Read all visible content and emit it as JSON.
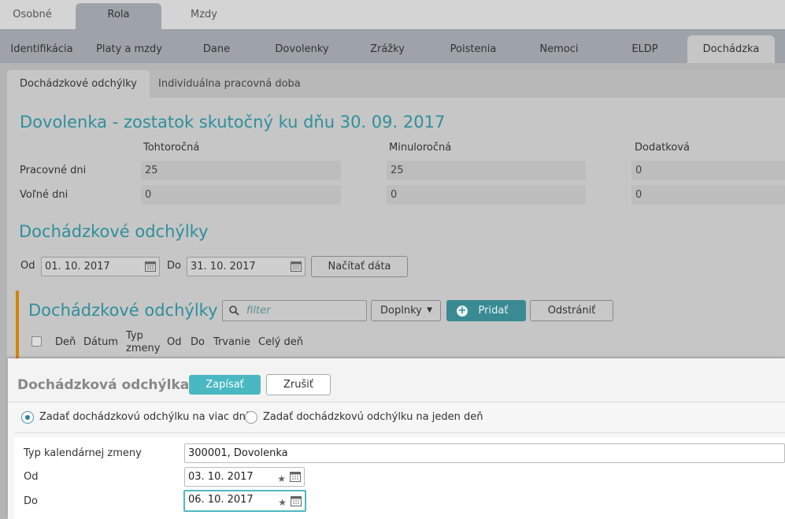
{
  "top_tabs": [
    "Osobné",
    "Rola",
    "Mzdy"
  ],
  "sub_tabs": [
    "Identifikácia",
    "Platy a mzdy",
    "Dane",
    "Dovolenky",
    "Zrážky",
    "Poistenia",
    "Nemoci",
    "ELDP",
    "Dochádzka"
  ],
  "inner_tabs": [
    "Dochádzkové odchýlky",
    "Individuálna pracovná doba"
  ],
  "vacation": {
    "title": "Dovolenka - zostatok skutočný ku dňu 30. 09. 2017",
    "col1": "Tohtoročná",
    "col2": "Minuloročná",
    "col3": "Dodatková",
    "row1_label": "Pracovné dni",
    "row2_label": "Voľné dni",
    "row1": [
      "25",
      "25",
      "0"
    ],
    "row2": [
      "0",
      "0",
      "0"
    ]
  },
  "deviations": {
    "title": "Dochádzkové odchýlky",
    "from_label": "Od",
    "from_value": "01. 10. 2017",
    "to_label": "Do",
    "to_value": "31. 10. 2017",
    "load_button": "Načítať dáta"
  },
  "grid": {
    "title": "Dochádzkové odchýlky",
    "filter_placeholder": "filter",
    "addons_button": "Doplnky",
    "add_button": "Pridať",
    "remove_button": "Odstrániť",
    "columns": [
      "Deň",
      "Dátum",
      "Typ zmeny",
      "Od",
      "Do",
      "Trvanie",
      "Celý deň"
    ]
  },
  "modal": {
    "title": "Dochádzková odchýlka",
    "save_button": "Zapísať",
    "cancel_button": "Zrušiť",
    "radio_multi": "Zadať dochádzkovú odchýlku na viac dní",
    "radio_single": "Zadať dochádzkovú odchýlku na jeden deň",
    "type_label": "Typ kalendárnej zmeny",
    "type_value": "300001, Dovolenka",
    "from_label": "Od",
    "from_value": "03. 10. 2017",
    "to_label": "Do",
    "to_value": "06. 10. 2017"
  },
  "colors": {
    "accent": "#2f8f9b",
    "save": "#4ab8c2",
    "section_marker": "#d48300"
  }
}
